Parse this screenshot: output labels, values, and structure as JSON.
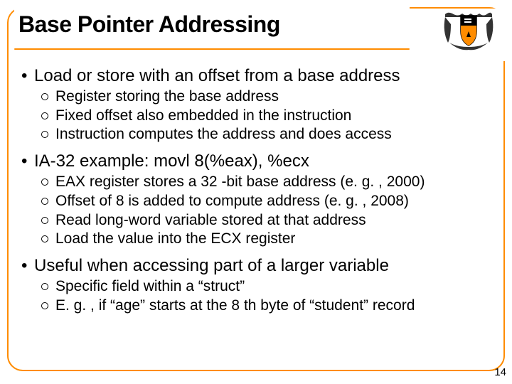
{
  "slide": {
    "title": "Base Pointer Addressing",
    "page_number": "14",
    "bullets": [
      {
        "text": "Load or store with an offset from a base address",
        "subs": [
          "Register storing the base address",
          "Fixed offset also embedded in the instruction",
          "Instruction computes the address and does access"
        ]
      },
      {
        "text": "IA-32 example: movl 8(%eax), %ecx",
        "subs": [
          "EAX register stores a 32 -bit base address (e. g. , 2000)",
          "Offset of 8 is added to compute address (e. g. , 2008)",
          "Read long-word variable stored at that address",
          "Load the value into the ECX register"
        ]
      },
      {
        "text": "Useful when accessing part of a larger variable",
        "subs": [
          "Specific field within a “struct”",
          "E. g. , if “age” starts at the 8 th byte of “student” record"
        ]
      }
    ]
  },
  "logo": {
    "name": "princeton-shield"
  }
}
